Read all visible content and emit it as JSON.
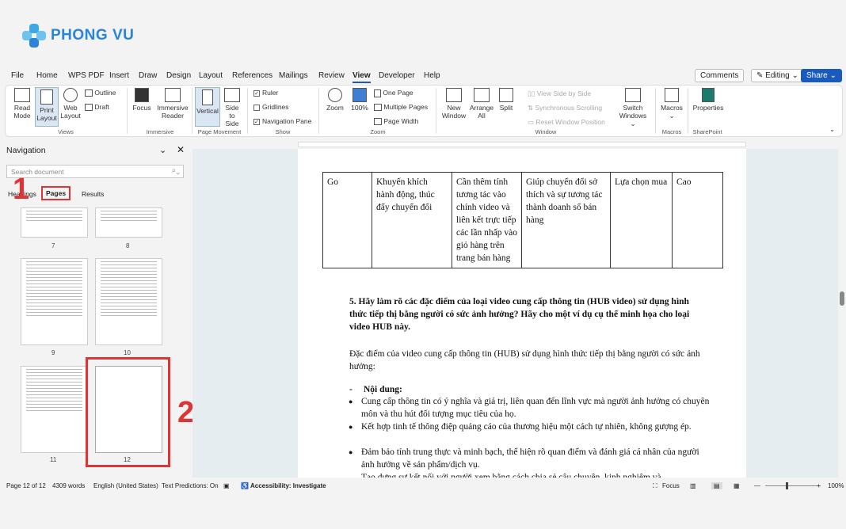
{
  "brand": {
    "name": "PHONG VU",
    "color": "#2a84d9"
  },
  "menu": [
    "File",
    "Home",
    "WPS PDF",
    "Insert",
    "Draw",
    "Design",
    "Layout",
    "References",
    "Mailings",
    "Review",
    "View",
    "Developer",
    "Help"
  ],
  "topright": {
    "comments": "Comments",
    "editing": "Editing",
    "share": "Share"
  },
  "ribbon": {
    "read_mode": "Read Mode",
    "print_layout": "Print Layout",
    "web_layout": "Web Layout",
    "outline": "Outline",
    "draft": "Draft",
    "views_group": "Views",
    "focus": "Focus",
    "immersive_reader": "Immersive Reader",
    "immersive_group": "Immersive",
    "vertical": "Vertical",
    "side_to_side": "Side to Side",
    "page_movement_group": "Page Movement",
    "ruler": "Ruler",
    "gridlines": "Gridlines",
    "navigation_pane": "Navigation Pane",
    "show_group": "Show",
    "zoom": "Zoom",
    "zoom_100": "100%",
    "one_page": "One Page",
    "multiple_pages": "Multiple Pages",
    "page_width": "Page Width",
    "zoom_group": "Zoom",
    "new_window": "New Window",
    "arrange_all": "Arrange All",
    "split": "Split",
    "view_side_by_side": "View Side by Side",
    "sync_scrolling": "Synchronous Scrolling",
    "reset_window": "Reset Window Position",
    "switch_windows": "Switch Windows",
    "window_group": "Window",
    "macros": "Macros",
    "macros_group": "Macros",
    "properties": "Properties",
    "sharepoint_group": "SharePoint"
  },
  "nav": {
    "title": "Navigation",
    "search_placeholder": "Search document",
    "tabs": [
      "Headings",
      "Pages",
      "Results"
    ],
    "page_numbers": [
      "7",
      "8",
      "9",
      "10",
      "11",
      "12"
    ]
  },
  "annotations": [
    "1",
    "2"
  ],
  "doc": {
    "table_row": [
      "Go",
      "Khuyến khích hành động, thúc đẩy chuyển đổi",
      "Cần thêm tính tương tác vào chính video và liên kết trực tiếp các lần nhấp vào giỏ hàng trên trang bán hàng",
      "Giúp chuyển đổi sở thích và sự tương tác thành doanh số bán hàng",
      "Lựa chọn mua",
      "Cao"
    ],
    "question": "5. Hãy làm rõ các đặc điểm của loại video cung cấp thông tin (HUB video) sử dụng hình thức tiếp thị bằng người có sức ảnh hưởng? Hãy cho một ví dụ cụ thể minh họa cho loại video HUB này.",
    "intro": "Đặc điểm của video cung cấp thông tin (HUB) sử dụng hình thức tiếp thị bằng người có sức ảnh hưởng:",
    "content_heading": "Nội dung:",
    "bullets": [
      "Cung cấp thông tin có ý nghĩa và giá trị, liên quan đến lĩnh vực mà người ảnh hưởng có chuyên môn và thu hút đối tượng mục tiêu của họ.",
      "Kết hợp tinh tế thông điệp quảng cáo của thương hiệu một cách tự nhiên, không gượng ép.",
      "Đảm bảo tính trung thực và minh bạch, thể hiện rõ quan điểm và đánh giá cá nhân của người ảnh hưởng về sản phẩm/dịch vụ.",
      "Tạo dựng sự kết nối với người xem bằng cách chia sẻ câu chuyện, kinh nghiệm và"
    ]
  },
  "status": {
    "page": "Page 12 of 12",
    "words": "4309 words",
    "language": "English (United States)",
    "predictions": "Text Predictions: On",
    "accessibility": "Accessibility: Investigate",
    "focus": "Focus",
    "zoom": "100%"
  }
}
